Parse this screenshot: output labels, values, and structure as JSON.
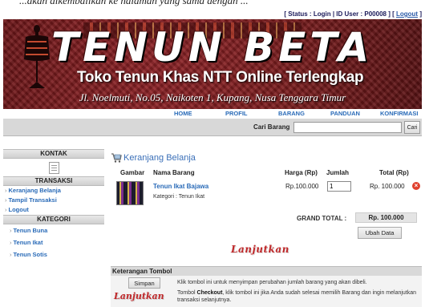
{
  "top_caption": "...akan dikembalikan ke halaman yang sama dengan ...",
  "status": {
    "prefix": "[ Status : Login | ID User : P00008 ] [",
    "logout": "Logout",
    "suffix": "]"
  },
  "banner": {
    "brand": "TENUN BETA",
    "tagline": "Toko Tenun Khas NTT Online Terlengkap",
    "address": "Jl. Noelmuti, No.05, Naikoten 1, Kupang, Nusa Tenggara Timur"
  },
  "nav": [
    "HOME",
    "PROFIL",
    "BARANG",
    "PANDUAN",
    "KONFIRMASI"
  ],
  "search": {
    "label": "Cari Barang",
    "value": "",
    "placeholder": "",
    "button": "Cari"
  },
  "sidebar": {
    "kontak_title": "KONTAK",
    "transaksi_title": "TRANSAKSI",
    "transaksi_items": [
      "Keranjang Belanja",
      "Tampil Transaksi",
      "Logout"
    ],
    "kategori_title": "KATEGORI",
    "kategori_items": [
      "Tenun Buna",
      "Tenun Ikat",
      "Tenun Sotis"
    ]
  },
  "cart": {
    "title": "Keranjang Belanja",
    "headers": {
      "gambar": "Gambar",
      "nama": "Nama Barang",
      "harga": "Harga (Rp)",
      "jumlah": "Jumlah",
      "total": "Total (Rp)"
    },
    "items": [
      {
        "name": "Tenun Ikat Bajawa",
        "category": "Kategori : Tenun Ikat",
        "price": "Rp.100.000",
        "qty": "1",
        "total": "Rp. 100.000"
      }
    ],
    "grand_total_label": "GRAND TOTAL :",
    "grand_total_value": "Rp. 100.000",
    "update_button": "Ubah Data",
    "continue_label": "Lanjutkan"
  },
  "keterangan": {
    "title": "Keterangan Tombol",
    "simpan_button": "Simpan",
    "simpan_desc": "Klik tombol ini untuk menyimpan perubahan jumlah barang yang akan dibeli.",
    "lanjut_label": "Lanjutkan",
    "lanjut_desc_pre": "Tombol ",
    "lanjut_desc_bold": "Checkout",
    "lanjut_desc_post": ", klik tombol ini jika Anda sudah selesai memilih Barang dan ingin melanjutkan transaksi selanjutnya."
  },
  "colors": {
    "banner": "#7a1c1d",
    "link": "#2a6bb8",
    "accent": "#c0282a"
  },
  "icons": [
    "mannequin-icon",
    "document-icon",
    "cart-icon",
    "delete-icon",
    "arrow-icon"
  ]
}
